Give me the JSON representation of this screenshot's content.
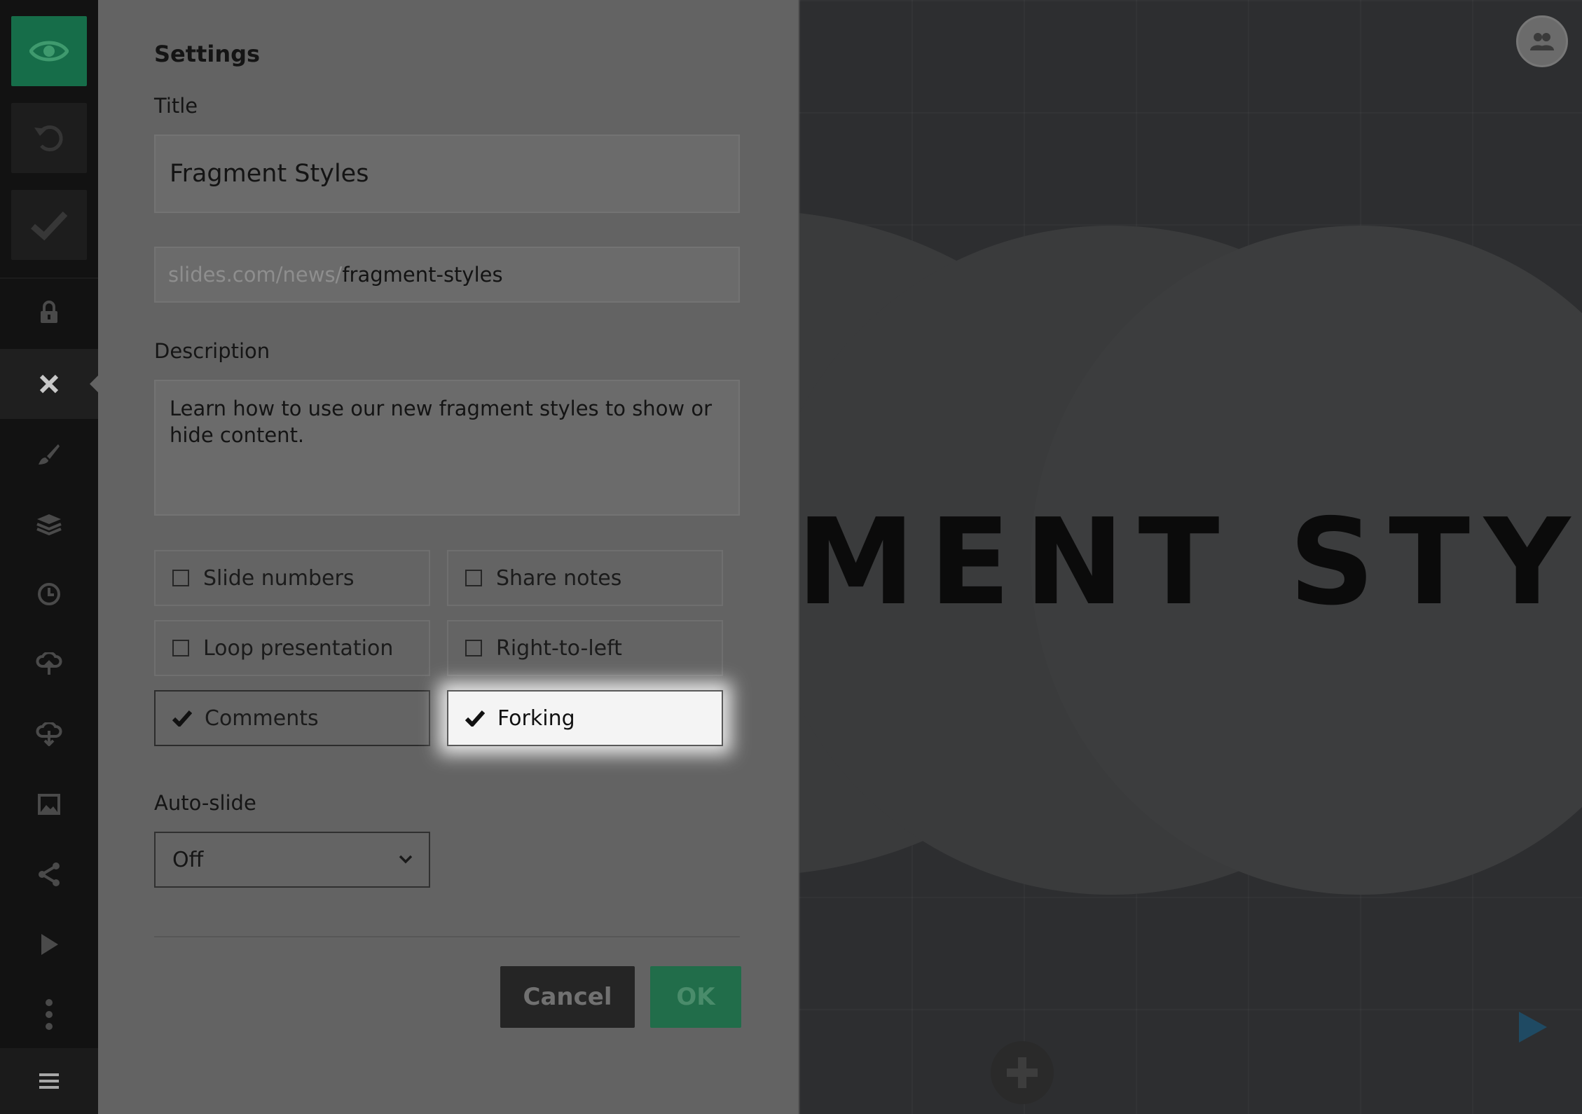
{
  "panel": {
    "heading": "Settings",
    "title_label": "Title",
    "title_value": "Fragment Styles",
    "url_prefix": "slides.com/news/",
    "url_slug": "fragment-styles",
    "description_label": "Description",
    "description_value": "Learn how to use our new fragment styles to show or hide content.",
    "options": [
      {
        "label": "Slide numbers",
        "checked": false
      },
      {
        "label": "Share notes",
        "checked": false
      },
      {
        "label": "Loop presentation",
        "checked": false
      },
      {
        "label": "Right-to-left",
        "checked": false
      },
      {
        "label": "Comments",
        "checked": true
      },
      {
        "label": "Forking",
        "checked": true
      }
    ],
    "autoslide_label": "Auto-slide",
    "autoslide_value": "Off",
    "cancel_label": "Cancel",
    "ok_label": "OK"
  },
  "canvas": {
    "slide_title": "MENT STYLES"
  },
  "colors": {
    "accent_green": "#166d49",
    "panel_bg": "#636363",
    "toolbar_bg": "#121212"
  },
  "icons": {
    "toolbar": [
      "eye-icon",
      "undo-icon",
      "check-icon",
      "lock-icon",
      "close-icon",
      "brush-icon",
      "layers-icon",
      "clock-icon",
      "cloud-upload-icon",
      "cloud-download-icon",
      "image-icon",
      "share-icon",
      "play-icon",
      "more-vertical-icon",
      "menu-icon"
    ]
  }
}
